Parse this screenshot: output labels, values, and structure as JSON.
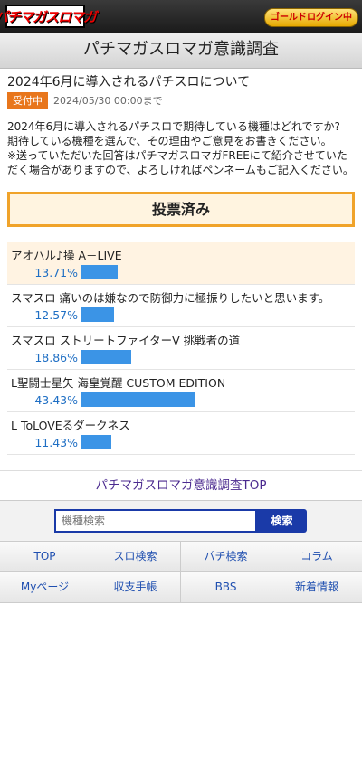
{
  "header": {
    "logo_text": "パチマガスロマガ",
    "gold_login": "ゴールドログイン中"
  },
  "page_title": "パチマガスロマガ意識調査",
  "survey": {
    "title": "2024年6月に導入されるパチスロについて",
    "status_badge": "受付中",
    "deadline": "2024/05/30 00:00まで",
    "description": [
      "2024年6月に導入されるパチスロで期待している機種はどれですか?",
      "期待している機種を選んで、その理由やご意見をお書きください。",
      "※送っていただいた回答はパチマガスロマガFREEにて紹介させていただく場合がありますので、よろしければペンネームもご記入ください。"
    ],
    "voted_label": "投票済み",
    "options": [
      {
        "label": "アオハル♪操 A－LIVE",
        "percent": "13.71%",
        "value": 13.71,
        "selected": true
      },
      {
        "label": "スマスロ 痛いのは嫌なので防御力に極振りしたいと思います。",
        "percent": "12.57%",
        "value": 12.57,
        "selected": false
      },
      {
        "label": "スマスロ ストリートファイターV 挑戦者の道",
        "percent": "18.86%",
        "value": 18.86,
        "selected": false
      },
      {
        "label": "L聖闘士星矢 海皇覚醒 CUSTOM EDITION",
        "percent": "43.43%",
        "value": 43.43,
        "selected": false
      },
      {
        "label": "L ToLOVEるダークネス",
        "percent": "11.43%",
        "value": 11.43,
        "selected": false
      }
    ]
  },
  "footer_link": "パチマガスロマガ意識調査TOP",
  "search": {
    "placeholder": "機種検索",
    "button": "検索"
  },
  "nav": [
    "TOP",
    "スロ検索",
    "パチ検索",
    "コラム",
    "Myページ",
    "収支手帳",
    "BBS",
    "新着情報"
  ]
}
